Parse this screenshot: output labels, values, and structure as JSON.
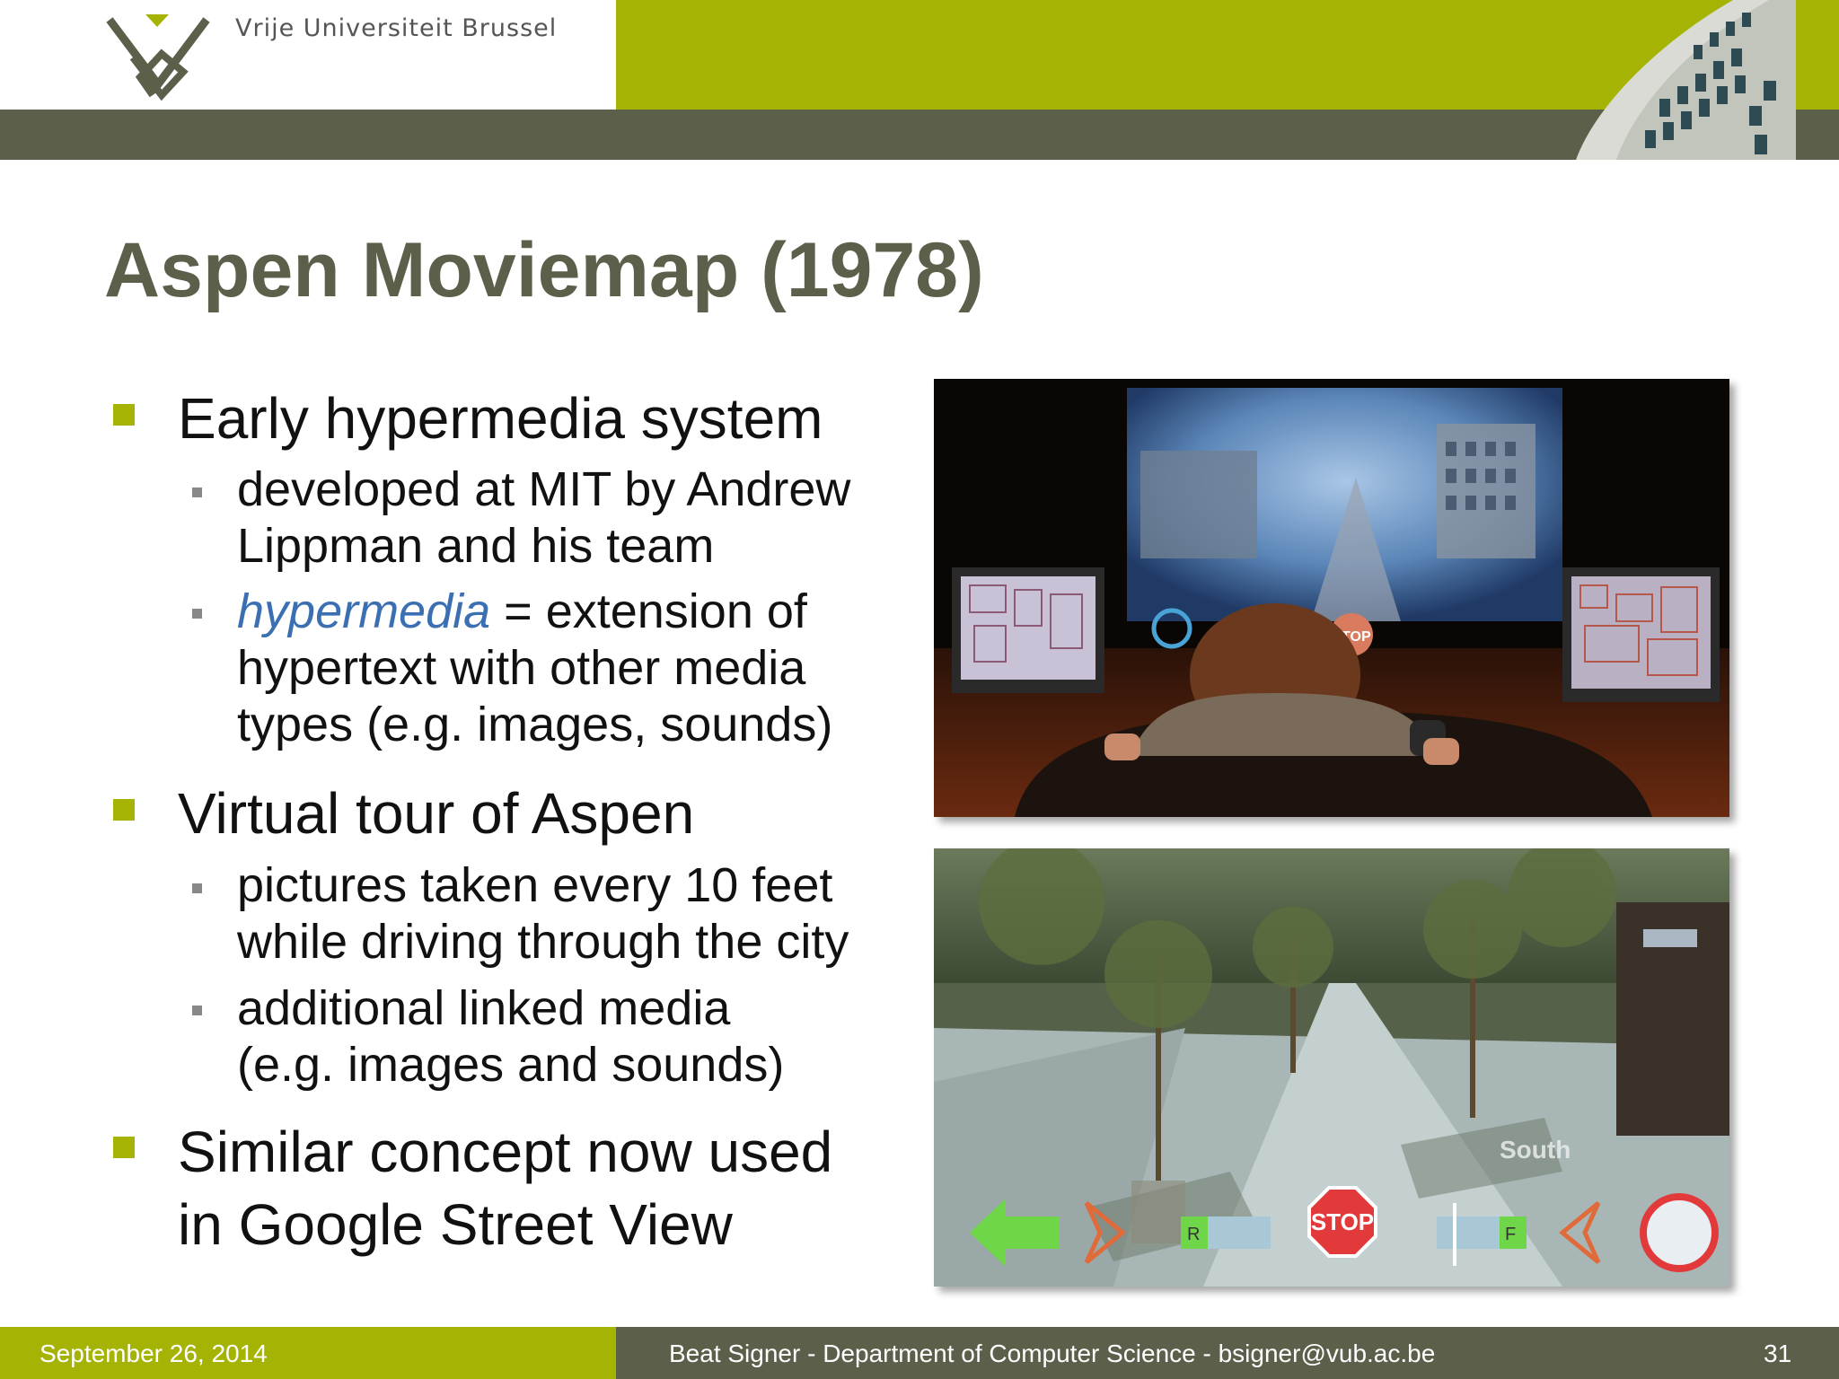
{
  "header": {
    "university": "Vrije Universiteit  Brussel"
  },
  "slide": {
    "title": "Aspen Moviemap (1978)",
    "bullets": [
      {
        "text": "Early hypermedia system",
        "sub": [
          {
            "lines": [
              "developed at MIT by Andrew",
              "Lippman and his team"
            ]
          },
          {
            "emphasis": "hypermedia",
            "first_rest": " = extension of",
            "lines_rest": [
              "hypertext with other media",
              "types (e.g. images, sounds)"
            ]
          }
        ]
      },
      {
        "text": "Virtual tour of Aspen",
        "sub": [
          {
            "lines": [
              "pictures taken every 10 feet",
              "while driving through the city"
            ]
          },
          {
            "lines": [
              "additional linked media",
              "(e.g. images and sounds)"
            ]
          }
        ]
      },
      {
        "lines": [
          "Similar concept now used",
          "in Google Street View"
        ]
      }
    ],
    "photo1": {
      "overlay_stop": "STOP"
    },
    "photo2": {
      "overlay_stop": "STOP",
      "overlay_direction": "South",
      "overlay_r": "R",
      "overlay_f": "F"
    }
  },
  "footer": {
    "date": "September 26, 2014",
    "author": "Beat Signer - Department of Computer Science - bsigner@vub.ac.be",
    "page": "31"
  },
  "colors": {
    "accent_green": "#a5b404",
    "band_grey": "#5c5f4a",
    "emphasis_blue": "#3b6fb2"
  }
}
